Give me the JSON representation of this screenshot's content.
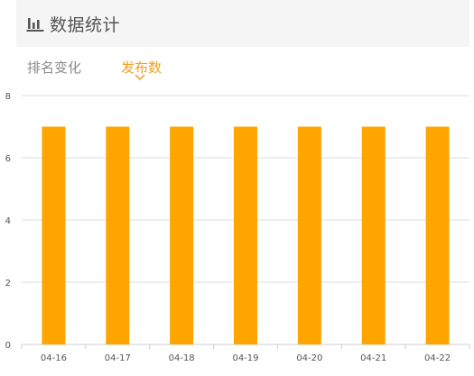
{
  "header": {
    "title": "数据统计",
    "icon": "bar-chart-icon"
  },
  "tabs": [
    {
      "label": "排名变化",
      "active": false
    },
    {
      "label": "发布数",
      "active": true
    }
  ],
  "colors": {
    "accent": "#f0a020",
    "bar": "#ffa500",
    "inactive_tab": "#8a8a8a",
    "header_bg": "#f5f5f5"
  },
  "chart_data": {
    "type": "bar",
    "categories": [
      "04-16",
      "04-17",
      "04-18",
      "04-19",
      "04-20",
      "04-21",
      "04-22"
    ],
    "values": [
      7,
      7,
      7,
      7,
      7,
      7,
      7
    ],
    "title": "",
    "xlabel": "",
    "ylabel": "",
    "ylim": [
      0,
      8
    ],
    "yticks": [
      "0",
      "2",
      "4",
      "6",
      "8"
    ],
    "grid": true
  }
}
